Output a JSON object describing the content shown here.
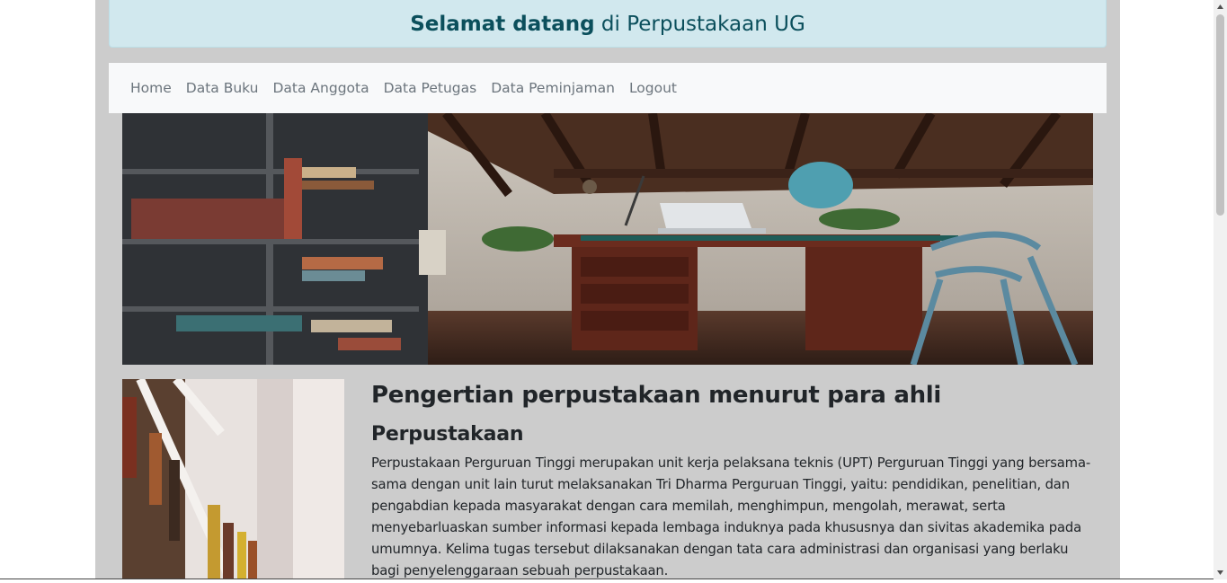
{
  "header": {
    "title_bold": "Selamat datang",
    "title_rest": " di Perpustakaan UG"
  },
  "nav": {
    "items": [
      "Home",
      "Data Buku",
      "Data Anggota",
      "Data Petugas",
      "Data Peminjaman",
      "Logout"
    ]
  },
  "images": {
    "hero": "library-study-room-image",
    "side": "bookshelf-image"
  },
  "article": {
    "heading": "Pengertian perpustakaan menurut para ahli",
    "subheading": "Perpustakaan",
    "body": "Perpustakaan Perguruan Tinggi merupakan unit kerja pelaksana teknis (UPT) Perguruan Tinggi yang bersama-sama dengan unit lain turut melaksanakan Tri Dharma Perguruan Tinggi, yaitu: pendidikan, penelitian, dan pengabdian kepada masyarakat dengan cara memilah, menghimpun, mengolah, merawat, serta menyebarluaskan sumber informasi kepada lembaga induknya pada khususnya dan sivitas akademika pada umumnya. Kelima tugas tersebut dilaksanakan dengan tata cara administrasi dan organisasi yang berlaku bagi penyelenggaraan sebuah perpustakaan."
  },
  "colors": {
    "page_bg": "#cccccc",
    "alert_bg": "#d1e8ee",
    "alert_text": "#0b4f5c",
    "nav_bg": "#f8f9fa",
    "nav_text": "#6c757d"
  }
}
